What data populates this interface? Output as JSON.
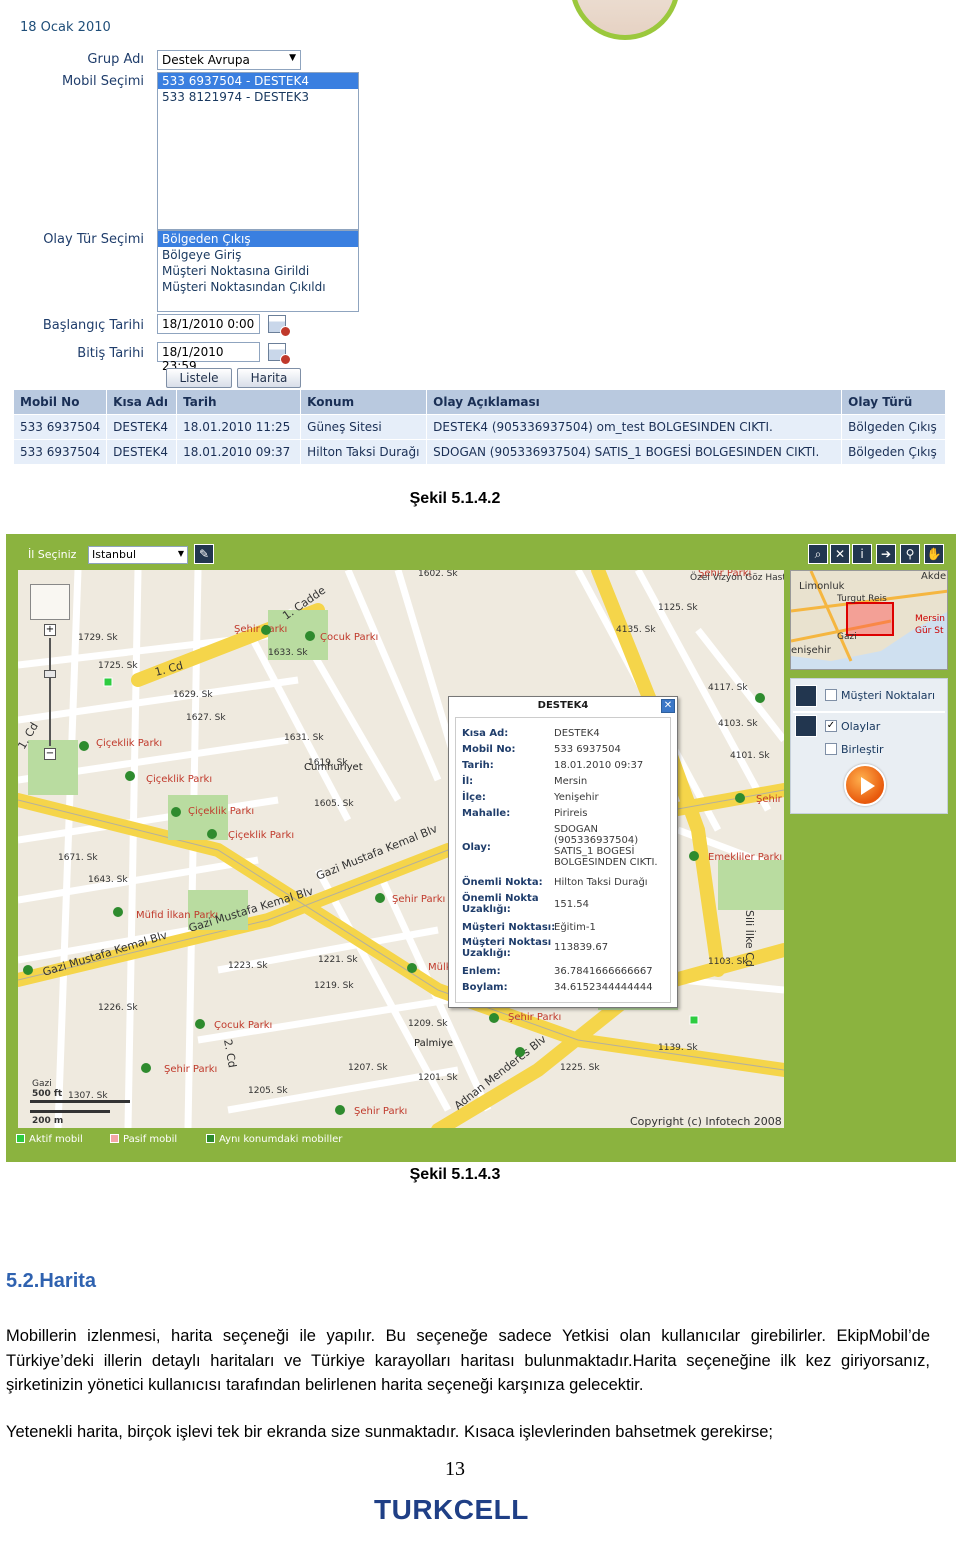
{
  "form": {
    "date": "18 Ocak 2010",
    "group_label": "Grup Adı",
    "group_value": "Destek Avrupa",
    "mobile_label": "Mobil Seçimi",
    "mobiles": [
      "533 6937504 - DESTEK4",
      "533 8121974 - DESTEK3"
    ],
    "event_type_label": "Olay Tür Seçimi",
    "event_types": [
      "Bölgeden Çıkış",
      "Bölgeye Giriş",
      "Müşteri Noktasına Girildi",
      "Müşteri Noktasından Çıkıldı"
    ],
    "start_label": "Başlangıç Tarihi",
    "start_value": "18/1/2010 0:00",
    "end_label": "Bitiş Tarihi",
    "end_value": "18/1/2010 23:59",
    "list_button": "Listele",
    "map_button": "Harita"
  },
  "table": {
    "headers": [
      "Mobil No",
      "Kısa Adı",
      "Tarih",
      "Konum",
      "Olay Açıklaması",
      "Olay Türü"
    ],
    "rows": [
      [
        "533 6937504",
        "DESTEK4",
        "18.01.2010 11:25",
        "Güneş Sitesi",
        "DESTEK4 (905336937504) om_test BOLGESINDEN CIKTI.",
        "Bölgeden Çıkış"
      ],
      [
        "533 6937504",
        "DESTEK4",
        "18.01.2010 09:37",
        "Hilton Taksi Durağı",
        "SDOGAN (905336937504) SATIS_1 BOGESİ BOLGESINDEN CIKTI.",
        "Bölgeden Çıkış"
      ]
    ]
  },
  "caption1": "Şekil 5.1.4.2",
  "map": {
    "city_label": "İl Seçiniz",
    "city_value": "Istanbul",
    "popup": {
      "title": "DESTEK4",
      "fields": [
        {
          "k": "Kısa Ad:",
          "v": "DESTEK4"
        },
        {
          "k": "Mobil No:",
          "v": "533 6937504"
        },
        {
          "k": "Tarih:",
          "v": "18.01.2010 09:37"
        },
        {
          "k": "İl:",
          "v": "Mersin"
        },
        {
          "k": "İlçe:",
          "v": "Yenişehir"
        },
        {
          "k": "Mahalle:",
          "v": "Pirireis"
        },
        {
          "k": "Olay:",
          "v": "SDOGAN (905336937504) SATIS_1 BOGESİ BOLGESINDEN CIKTI."
        },
        {
          "k": "Önemli Nokta:",
          "v": "Hilton Taksi Durağı"
        },
        {
          "k": "Önemli Nokta Uzaklığı:",
          "v": "151.54"
        },
        {
          "k": "Müşteri Noktası:",
          "v": "Eğitim-1"
        },
        {
          "k": "Müşteri Noktası Uzaklığı:",
          "v": "113839.67"
        },
        {
          "k": "Enlem:",
          "v": "36.7841666666667"
        },
        {
          "k": "Boylam:",
          "v": "34.6152344444444"
        }
      ]
    },
    "layers": {
      "customer_points": "Müşteri Noktaları",
      "events": "Olaylar",
      "merge": "Birleştir"
    },
    "minimap_labels": [
      "Limonluk",
      "Akde",
      "Turgut Reis",
      "Mersin",
      "Gür St",
      "Gazi",
      "enişehir"
    ],
    "scale": {
      "place": "Gazi",
      "ft": "500 ft",
      "m": "200 m"
    },
    "copyright": "Copyright (c) Infotech 2008",
    "legend": {
      "active": "Aktif mobil",
      "passive": "Pasif mobil",
      "same_location": "Aynı konumdaki mobiller"
    },
    "parks": [
      "Şehir Parkı",
      "Çocuk Parkı",
      "Çiçeklik Parkı",
      "Çiçeklik Parkı",
      "Çiçeklik Parkı",
      "Çiçeklik Parkı",
      "Şehir Parkı",
      "Müfid İlkan Parkı",
      "Mülk",
      "Çocuk Parkı",
      "Şehir Parkı",
      "Şehir Parkı",
      "Şehir Parkı",
      "Emekliler Parkı",
      "Şehir",
      "Şehir Parkı"
    ],
    "districts": [
      "Cumhuriyet",
      "Palmiye"
    ],
    "avenues": [
      "Gazi Mustafa Kemal Blv",
      "Gazi Mustafa Kemal Blv",
      "Gazi Mustafa Kemal Blv",
      "Adnan Menderes Blv",
      "Sili İlke Cd",
      "1. Cd",
      "1. Cd",
      "1. Cadde",
      "2. Cd"
    ],
    "hotel": "Özel Vizyon Göz Hastanesi"
  },
  "caption2": "Şekil 5.1.4.3",
  "section": {
    "heading": "5.2.Harita",
    "p1": "Mobillerin izlenmesi, harita seçeneği ile yapılır. Bu seçeneğe sadece Yetkisi olan kullanıcılar girebilirler. EkipMobil’de Türkiye’deki illerin detaylı haritaları ve Türkiye karayolları haritası bulunmaktadır.Harita seçeneğine ilk kez giriyorsanız, şirketinizin yönetici kullanıcısı tarafından belirlenen harita seçeneği karşınıza gelecektir.",
    "p2": "Yetenekli harita, birçok işlevi tek bir ekranda size sunmaktadır. Kısaca işlevlerinden bahsetmek gerekirse;"
  },
  "page_number": "13",
  "logo": "TURKCELL"
}
